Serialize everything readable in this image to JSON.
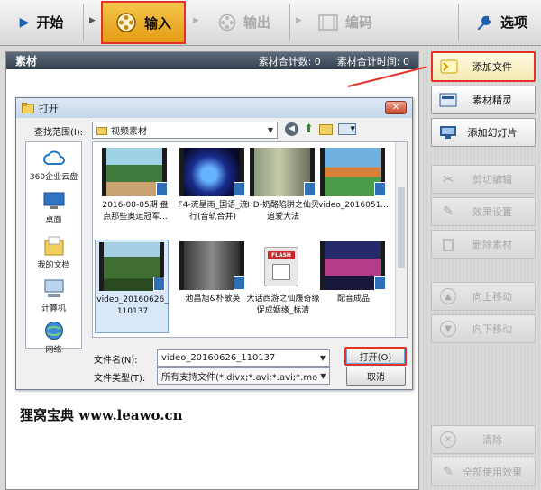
{
  "toolbar": {
    "start_label": "开始",
    "input_label": "输入",
    "output_label": "输出",
    "encode_label": "编码",
    "options_label": "选项"
  },
  "workspace": {
    "header_title": "素材",
    "count_label": "素材合计数: 0",
    "time_label": "素材合计时间: 0"
  },
  "watermark": "狸窝宝典  www.leawo.cn",
  "right_panel": {
    "add_file": "添加文件",
    "material_wizard": "素材精灵",
    "add_slideshow": "添加幻灯片",
    "cut_edit": "剪切编辑",
    "effect_settings": "效果设置",
    "delete_material": "删除素材",
    "move_up": "向上移动",
    "move_down": "向下移动",
    "clear": "清除",
    "apply_all_effects": "全部使用效果"
  },
  "dialog": {
    "title": "打开",
    "close_glyph": "✕",
    "look_in_label": "查找范围(I):",
    "look_in_value": "视频素材",
    "places": [
      "360企业云盘",
      "桌面",
      "我的文档",
      "计算机",
      "网络"
    ],
    "files": [
      {
        "name": "2016-08-05期 盘点那些奥运冠军..."
      },
      {
        "name": "F4-流星雨_国语_流行(音轨合并)"
      },
      {
        "name": "HD-奶酪陷阱之仙贝追爱大法"
      },
      {
        "name": "video_2016051..."
      },
      {
        "name": "video_20160626_110137"
      },
      {
        "name": "池昌旭&朴敏英"
      },
      {
        "name": "大话西游之仙履奇缘 促成姻缘_标清"
      },
      {
        "name": "配音成品"
      }
    ],
    "flash_tag": "FLASH",
    "filename_label": "文件名(N):",
    "filename_value": "video_20160626_110137",
    "filetype_label": "文件类型(T):",
    "filetype_value": "所有支持文件(*.divx;*.avi;*.avi;*.mod",
    "open_button": "打开(O)",
    "cancel_button": "取消"
  },
  "colors": {
    "highlight_red": "#e4322b",
    "input_tab_gold": "#f3c64c",
    "header_dark": "#36414f"
  }
}
